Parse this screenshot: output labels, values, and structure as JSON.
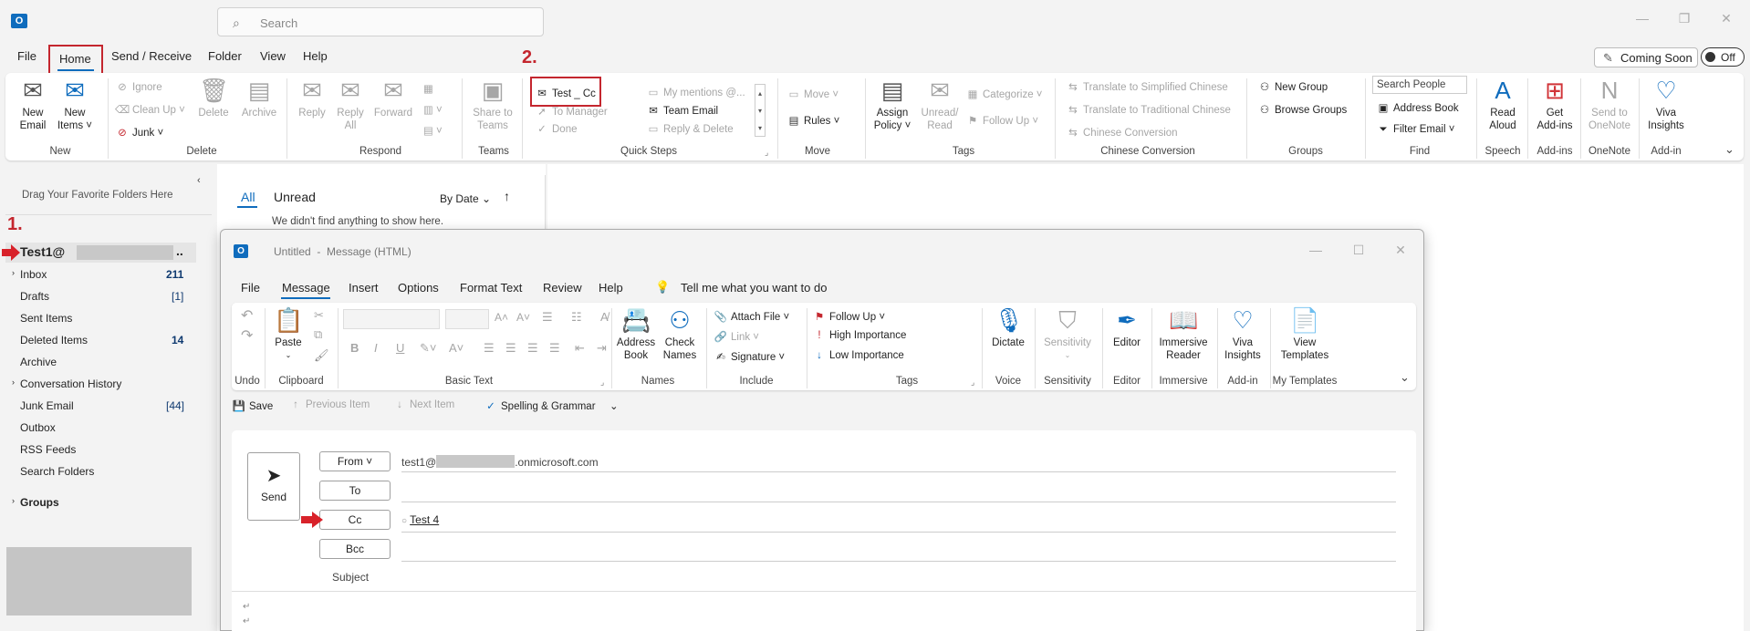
{
  "app": {
    "search_placeholder": "Search",
    "icon_letter": "O"
  },
  "menu": {
    "file": "File",
    "home": "Home",
    "send_receive": "Send / Receive",
    "folder": "Folder",
    "view": "View",
    "help": "Help",
    "coming_soon": "Coming Soon",
    "toggle": "Off"
  },
  "ribbon": {
    "new_email": "New\nEmail",
    "new_items": "New\nItems ˅",
    "grp_new": "New",
    "ignore": "Ignore",
    "clean_up": "Clean Up ˅",
    "junk": "Junk ˅",
    "delete": "Delete",
    "archive": "Archive",
    "grp_delete": "Delete",
    "reply": "Reply",
    "reply_all": "Reply\nAll",
    "forward": "Forward",
    "grp_respond": "Respond",
    "share_teams": "Share to\nTeams",
    "grp_teams": "Teams",
    "qs_test_cc": "Test _ Cc",
    "qs_to_manager": "To Manager",
    "qs_done": "Done",
    "qs_my_mentions": "My mentions @...",
    "qs_team_email": "Team Email",
    "qs_reply_delete": "Reply & Delete",
    "grp_quicksteps": "Quick Steps",
    "move": "Move ˅",
    "rules": "Rules ˅",
    "grp_move": "Move",
    "assign_policy": "Assign\nPolicy ˅",
    "unread_read": "Unread/\nRead",
    "categorize": "Categorize ˅",
    "follow_up": "Follow Up ˅",
    "grp_tags": "Tags",
    "translate_simplified": "Translate to Simplified Chinese",
    "translate_traditional": "Translate to Traditional Chinese",
    "chinese_conversion": "Chinese Conversion",
    "grp_chinese": "Chinese Conversion",
    "new_group": "New Group",
    "browse_groups": "Browse Groups",
    "grp_groups": "Groups",
    "search_people": "Search People",
    "address_book": "Address Book",
    "filter_email": "Filter Email ˅",
    "grp_find": "Find",
    "read_aloud": "Read\nAloud",
    "grp_speech": "Speech",
    "get_addins": "Get\nAdd-ins",
    "grp_addins": "Add-ins",
    "send_onenote": "Send to\nOneNote",
    "grp_onenote": "OneNote",
    "viva_insights": "Viva\nInsights",
    "grp_addin": "Add-in"
  },
  "annotations": {
    "one": "1.",
    "two": "2."
  },
  "nav": {
    "favorites": "Drag Your Favorite Folders Here",
    "account": "Test1@",
    "account_suffix": "..",
    "items": [
      {
        "label": "Inbox",
        "count": "211"
      },
      {
        "label": "Drafts",
        "count": "[1]"
      },
      {
        "label": "Sent Items",
        "count": ""
      },
      {
        "label": "Deleted Items",
        "count": "14"
      },
      {
        "label": "Archive",
        "count": ""
      },
      {
        "label": "Conversation History",
        "count": ""
      },
      {
        "label": "Junk Email",
        "count": "[44]"
      },
      {
        "label": "Outbox",
        "count": ""
      },
      {
        "label": "RSS Feeds",
        "count": ""
      },
      {
        "label": "Search Folders",
        "count": ""
      }
    ],
    "groups": "Groups"
  },
  "list": {
    "tab_all": "All",
    "tab_unread": "Unread",
    "sort": "By Date",
    "empty": "We didn't find anything to show here."
  },
  "compose": {
    "title": "Untitled  -  Message (HTML)",
    "menu": {
      "file": "File",
      "message": "Message",
      "insert": "Insert",
      "options": "Options",
      "format_text": "Format Text",
      "review": "Review",
      "help": "Help",
      "tell_me": "Tell me what you want to do"
    },
    "ribbon": {
      "grp_undo": "Undo",
      "paste": "Paste",
      "grp_clipboard": "Clipboard",
      "grp_basic_text": "Basic Text",
      "address_book": "Address\nBook",
      "check_names": "Check\nNames",
      "grp_names": "Names",
      "attach_file": "Attach File ˅",
      "link": "Link ˅",
      "signature": "Signature ˅",
      "grp_include": "Include",
      "follow_up": "Follow Up ˅",
      "high_importance": "High Importance",
      "low_importance": "Low Importance",
      "grp_tags": "Tags",
      "dictate": "Dictate",
      "grp_voice": "Voice",
      "sensitivity": "Sensitivity",
      "grp_sensitivity": "Sensitivity",
      "editor": "Editor",
      "grp_editor": "Editor",
      "immersive_reader": "Immersive\nReader",
      "grp_immersive": "Immersive",
      "viva_insights": "Viva\nInsights",
      "grp_addin": "Add-in",
      "view_templates": "View\nTemplates",
      "grp_templates": "My Templates"
    },
    "qat": {
      "save": "Save",
      "previous": "Previous Item",
      "next": "Next Item",
      "spelling": "Spelling & Grammar"
    },
    "form": {
      "send": "Send",
      "from": "From ˅",
      "to": "To",
      "cc": "Cc",
      "bcc": "Bcc",
      "subject": "Subject",
      "from_value_prefix": "test1@",
      "from_value_suffix": ".onmicrosoft.com",
      "cc_value": "Test 4"
    }
  },
  "colors": {
    "accent": "#0f6cbd",
    "annotation_red": "#c4262e"
  }
}
